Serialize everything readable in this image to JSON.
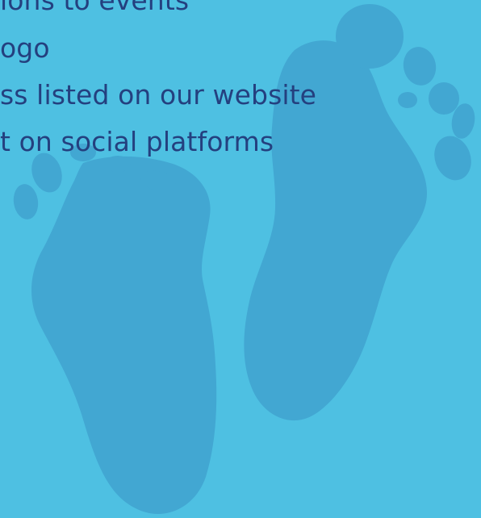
{
  "text_lines": [
    "ions to events",
    "ogo",
    "ss listed on our website",
    "t on social platforms"
  ],
  "colors": {
    "background": "#4ec0e2",
    "footprint": "#42a7d2",
    "text": "#24407f"
  }
}
